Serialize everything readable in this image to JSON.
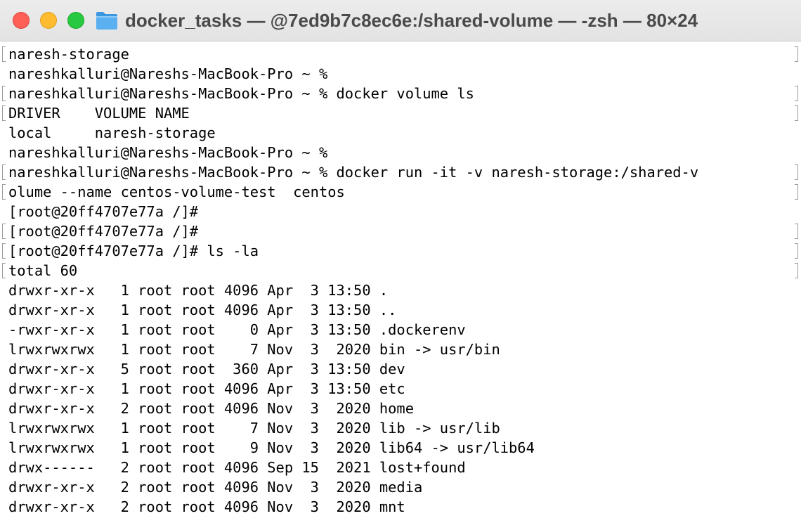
{
  "window": {
    "title": "docker_tasks — @7ed9b7c8ec6e:/shared-volume — -zsh — 80×24",
    "folder_icon": "folder-icon",
    "colors": {
      "close": "#fe5f57",
      "minimize": "#febc2e",
      "zoom": "#28c840",
      "folder": "#5ab0f0"
    }
  },
  "terminal": {
    "lines": [
      "naresh-storage",
      "nareshkalluri@Nareshs-MacBook-Pro ~ %",
      "nareshkalluri@Nareshs-MacBook-Pro ~ % docker volume ls",
      "DRIVER    VOLUME NAME",
      "local     naresh-storage",
      "nareshkalluri@Nareshs-MacBook-Pro ~ %",
      "nareshkalluri@Nareshs-MacBook-Pro ~ % docker run -it -v naresh-storage:/shared-v",
      "olume --name centos-volume-test  centos",
      "[root@20ff4707e77a /]#",
      "[root@20ff4707e77a /]#",
      "[root@20ff4707e77a /]# ls -la",
      "total 60",
      "drwxr-xr-x   1 root root 4096 Apr  3 13:50 .",
      "drwxr-xr-x   1 root root 4096 Apr  3 13:50 ..",
      "-rwxr-xr-x   1 root root    0 Apr  3 13:50 .dockerenv",
      "lrwxrwxrwx   1 root root    7 Nov  3  2020 bin -> usr/bin",
      "drwxr-xr-x   5 root root  360 Apr  3 13:50 dev",
      "drwxr-xr-x   1 root root 4096 Apr  3 13:50 etc",
      "drwxr-xr-x   2 root root 4096 Nov  3  2020 home",
      "lrwxrwxrwx   1 root root    7 Nov  3  2020 lib -> usr/lib",
      "lrwxrwxrwx   1 root root    9 Nov  3  2020 lib64 -> usr/lib64",
      "drwx------   2 root root 4096 Sep 15  2021 lost+found",
      "drwxr-xr-x   2 root root 4096 Nov  3  2020 media",
      "drwxr-xr-x   2 root root 4096 Nov  3  2020 mnt"
    ]
  }
}
